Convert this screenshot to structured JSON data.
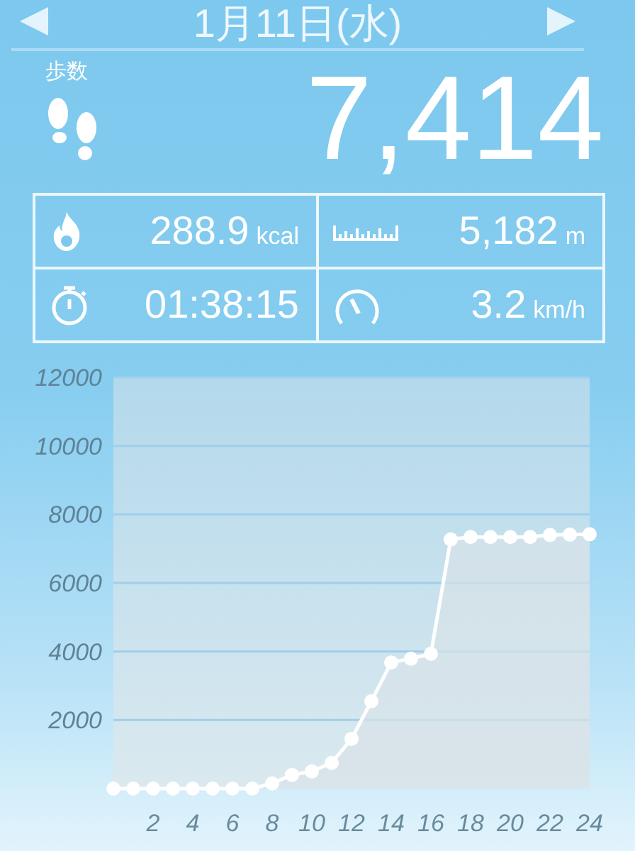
{
  "header": {
    "date": "1月11日(水)"
  },
  "steps": {
    "label": "歩数",
    "value": "7,414"
  },
  "stats": [
    {
      "kind": "calories",
      "value": "288.9",
      "unit": "kcal"
    },
    {
      "kind": "distance",
      "value": "5,182",
      "unit": "m"
    },
    {
      "kind": "time",
      "value": "01:38:15"
    },
    {
      "kind": "speed",
      "value": "3.2",
      "unit": "km/h"
    }
  ],
  "chart": {
    "chart_data": {
      "type": "area",
      "x": [
        0,
        1,
        2,
        3,
        4,
        5,
        6,
        7,
        8,
        9,
        10,
        11,
        12,
        13,
        14,
        15,
        16,
        17,
        18,
        19,
        20,
        21,
        22,
        23,
        24
      ],
      "series": [
        {
          "color": "#ffffff",
          "values": [
            0,
            0,
            0,
            0,
            0,
            0,
            0,
            0,
            150,
            400,
            500,
            750,
            1450,
            2550,
            3680,
            3790,
            3930,
            7270,
            7340,
            7340,
            7340,
            7340,
            7400,
            7410,
            7420
          ]
        }
      ],
      "grid": true,
      "xlim": [
        0,
        24
      ],
      "ylim": [
        0,
        12000
      ],
      "xticks": [
        2,
        4,
        6,
        8,
        10,
        12,
        14,
        16,
        18,
        20,
        22,
        24
      ],
      "yticks": [
        2000,
        4000,
        6000,
        8000,
        10000,
        12000
      ]
    }
  }
}
